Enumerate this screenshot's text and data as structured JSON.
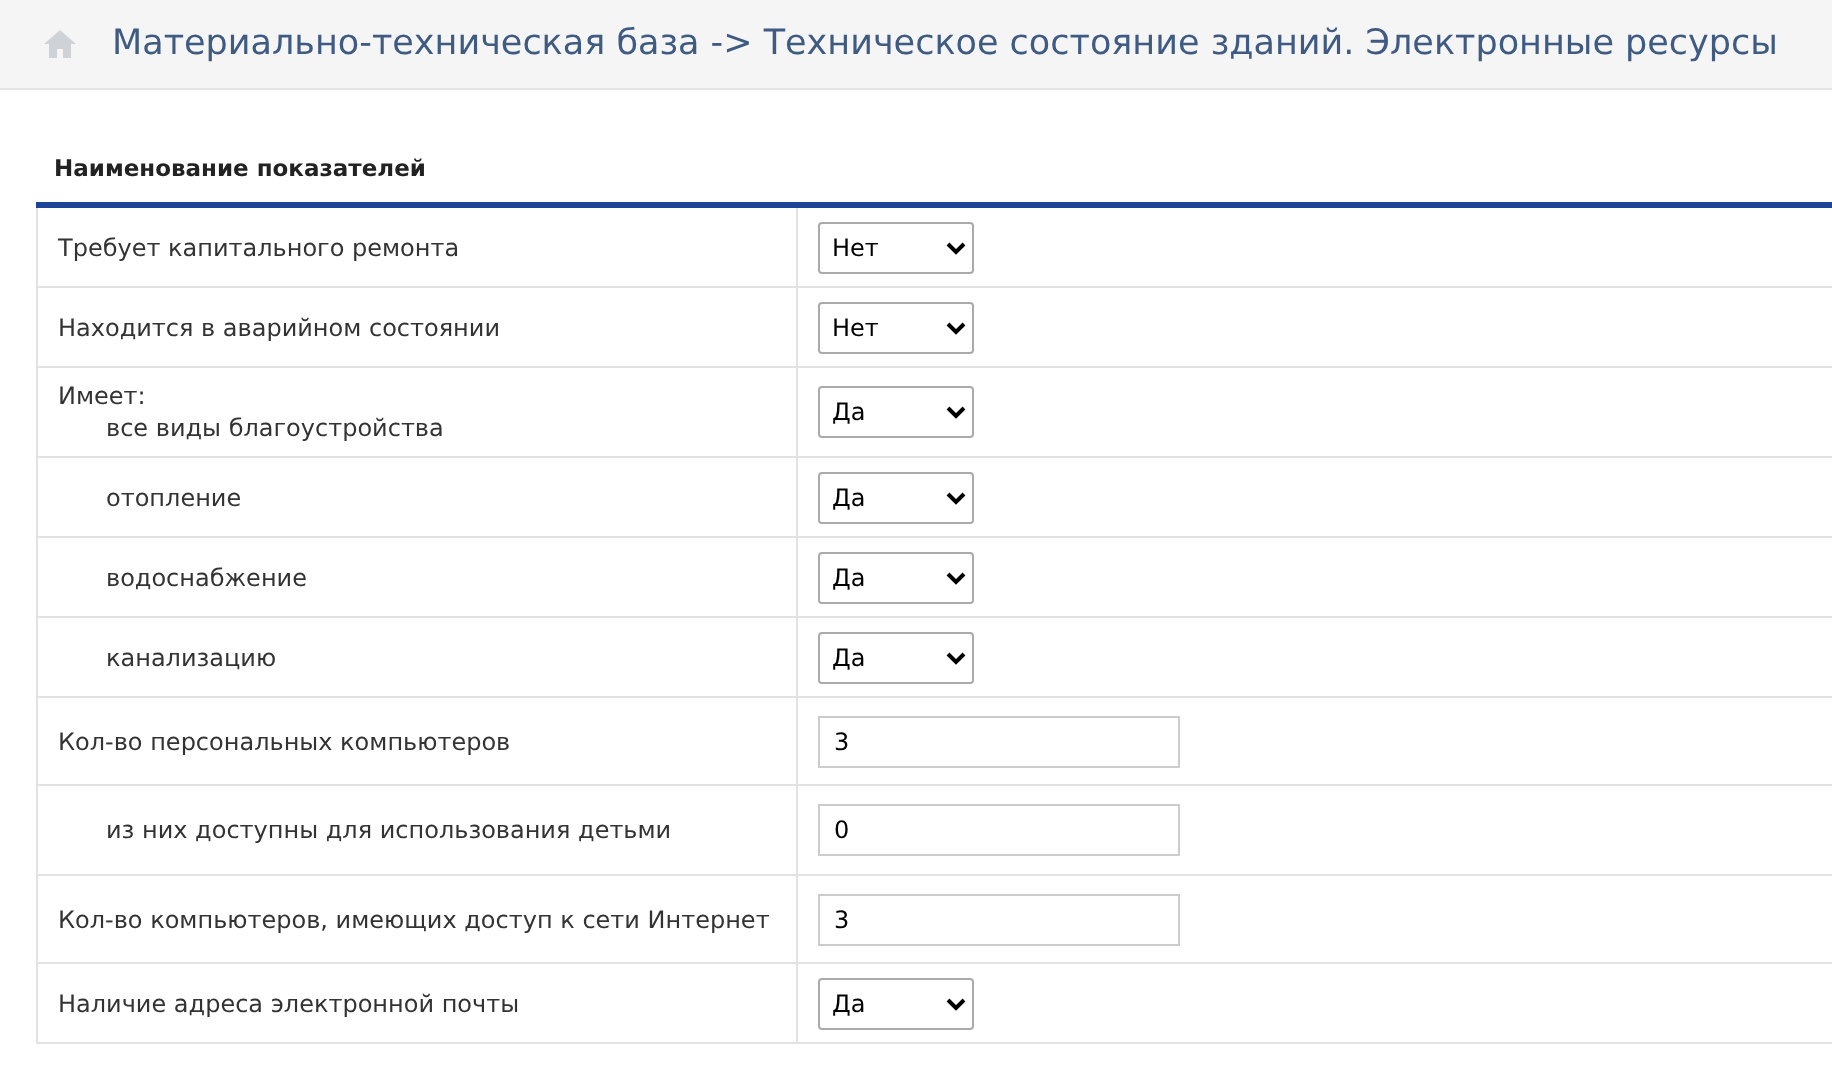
{
  "header": {
    "title": "Материально-техническая база -> Техническое состояние зданий. Электронные ресурсы"
  },
  "table": {
    "column_header": "Наименование показателей",
    "rows": [
      {
        "kind": "select",
        "label": "Требует капитального ремонта",
        "value": "Нет"
      },
      {
        "kind": "select",
        "label": "Находится в аварийном состоянии",
        "value": "Нет"
      },
      {
        "kind": "group",
        "label": "Имеет:",
        "children": [
          {
            "kind": "select",
            "label": "все виды благоустройства",
            "value": "Да"
          },
          {
            "kind": "select",
            "label": "отопление",
            "value": "Да"
          },
          {
            "kind": "select",
            "label": "водоснабжение",
            "value": "Да"
          },
          {
            "kind": "select",
            "label": "канализацию",
            "value": "Да"
          }
        ]
      },
      {
        "kind": "text",
        "label": "Кол-во персональных компьютеров",
        "value": "3",
        "children": [
          {
            "kind": "text",
            "label": "из них доступны для использования детьми",
            "value": "0"
          }
        ]
      },
      {
        "kind": "text",
        "label": "Кол-во компьютеров, имеющих доступ к сети Интернет",
        "value": "3"
      },
      {
        "kind": "select",
        "label": "Наличие адреса электронной почты",
        "value": "Да"
      }
    ]
  }
}
